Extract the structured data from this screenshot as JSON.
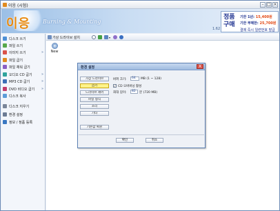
{
  "window": {
    "title": "이응 (시험)"
  },
  "banner": {
    "logo": "이응",
    "subtitle": "Burning & Mounting",
    "version": "1.62",
    "price_big": "정품 구매",
    "price_line1_label": "기한 1년:",
    "price_line1_value": "15,400원",
    "price_line2_label": "기한 무제한:",
    "price_line2_value": "25,700원",
    "price_note": "결제 즉시 일련번호 발급"
  },
  "sidebar": {
    "items": [
      {
        "label": "디스크 쓰기",
        "icon": "disc-write-icon",
        "color": "#4d8fd6",
        "arrow": false
      },
      {
        "label": "파일 쓰기",
        "icon": "file-write-icon",
        "color": "#57a84a",
        "arrow": false
      },
      {
        "label": "이미지 쓰기",
        "icon": "image-write-icon",
        "color": "#d9534a",
        "arrow": true
      },
      {
        "label": "파일 굽기",
        "icon": "file-burn-icon",
        "color": "#e08a1e",
        "arrow": false
      },
      {
        "label": "파일 채워 굽기",
        "icon": "file-fill-burn-icon",
        "color": "#8a5fc4",
        "arrow": false
      },
      {
        "label": "오디오 CD 굽기",
        "icon": "audio-cd-icon",
        "color": "#2fa39c",
        "arrow": true
      },
      {
        "label": "MP3 CD 굽기",
        "icon": "mp3-cd-icon",
        "color": "#3c6fb6",
        "arrow": true
      },
      {
        "label": "DVD 비디오 굽기",
        "icon": "dvd-video-icon",
        "color": "#c23b6b",
        "arrow": true
      },
      {
        "label": "디스크 복사",
        "icon": "disc-copy-icon",
        "color": "#5c9cd8",
        "arrow": false
      },
      {
        "label": "디스크 지우기",
        "icon": "disc-erase-icon",
        "color": "#7a8699",
        "arrow": false
      },
      {
        "label": "환경 설정",
        "icon": "settings-icon",
        "color": "#6b7b93",
        "arrow": false
      },
      {
        "label": "정보 / 정품 등록",
        "icon": "info-icon",
        "color": "#3a78c2",
        "arrow": false
      }
    ]
  },
  "toolbar": {
    "install_label": "가상 드라이브 설치",
    "icons": [
      "search-icon",
      "add-icon",
      "view-icon",
      "refresh-icon",
      "help-icon"
    ]
  },
  "drive": {
    "label": "New"
  },
  "dialog": {
    "title": "환경 설정",
    "close": "X",
    "nav": [
      {
        "label": "가상 드라이브",
        "active": false
      },
      {
        "label": "굽기",
        "active": true
      },
      {
        "label": "드라이브 제어",
        "active": false
      },
      {
        "label": "파일 형식",
        "active": false
      },
      {
        "label": "소리",
        "active": false
      },
      {
        "label": "기타",
        "active": false
      }
    ],
    "reset_label": "기본값 복원",
    "buffer_label": "버퍼 크기:",
    "buffer_value": "64",
    "buffer_unit": "MB (1 ~ 128)",
    "check_label": "CD 오버버닝 활성",
    "check_mark": "✓",
    "max_len_label": "최대 길이:",
    "max_len_value": "82",
    "max_len_unit": "분 (720 MB)",
    "ok_label": "확인",
    "cancel_label": "취소"
  }
}
